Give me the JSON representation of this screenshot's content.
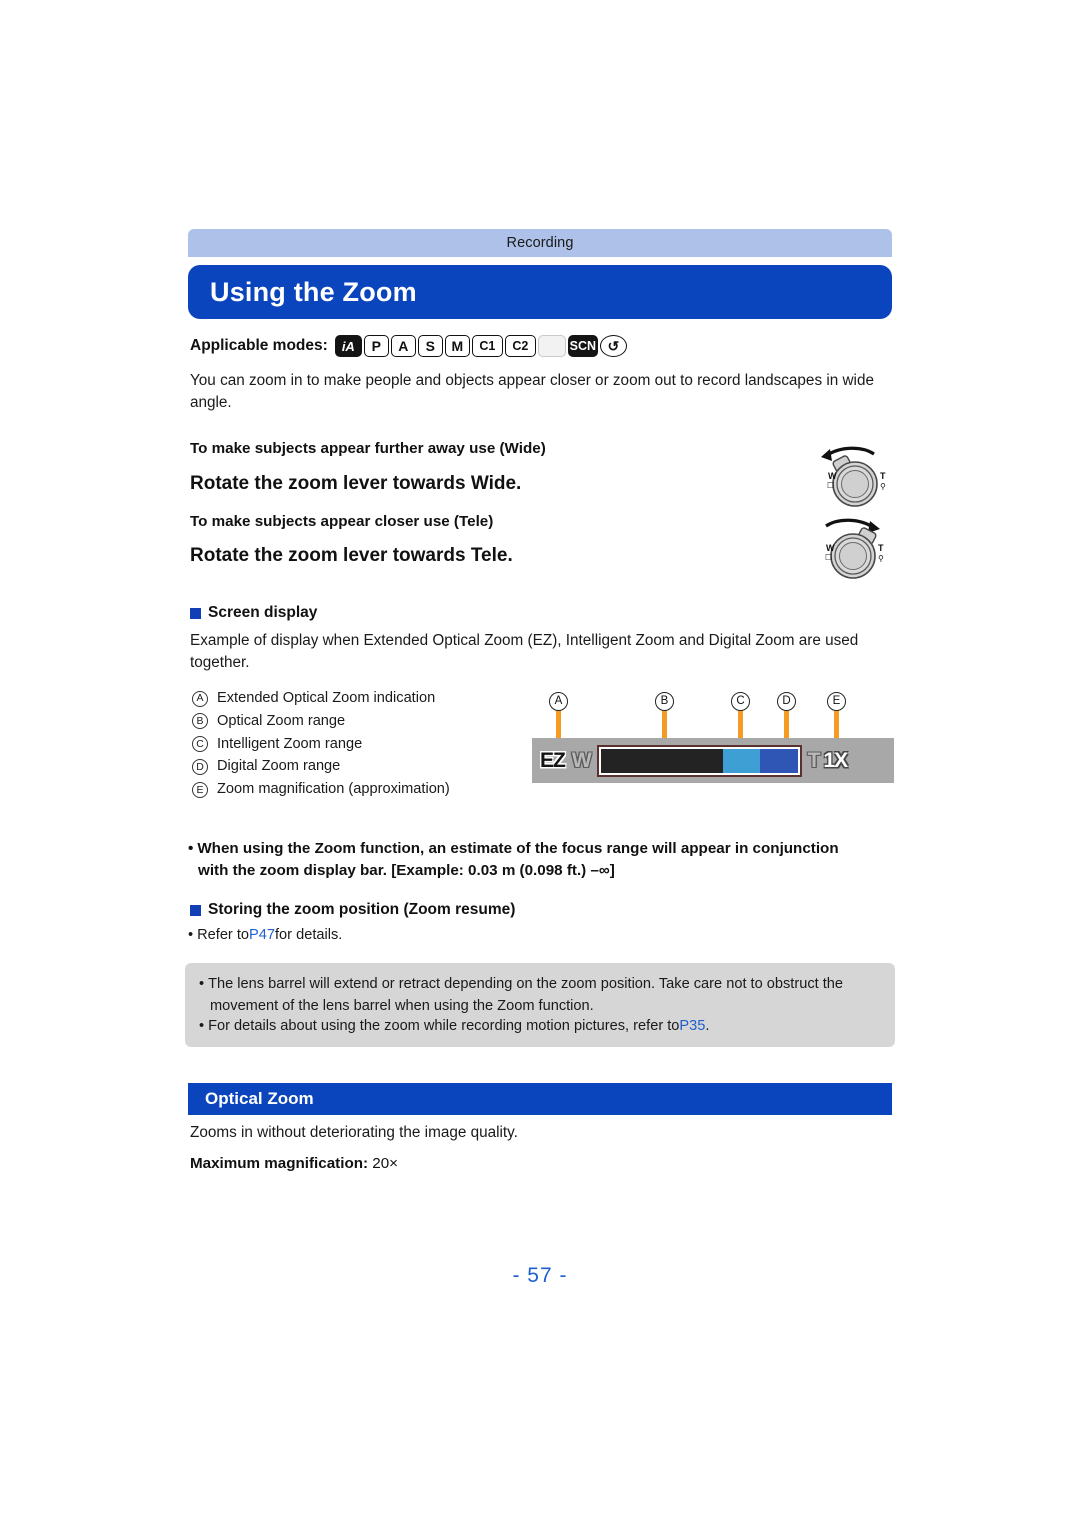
{
  "breadcrumb": {
    "label": "Recording"
  },
  "title": {
    "text": "Using the Zoom"
  },
  "applicable_modes": {
    "label": "Applicable modes:",
    "icons": [
      {
        "name": "mode-ia",
        "text": "iA",
        "style": "filled"
      },
      {
        "name": "mode-p",
        "text": "P",
        "style": "outline"
      },
      {
        "name": "mode-a",
        "text": "A",
        "style": "outline"
      },
      {
        "name": "mode-s",
        "text": "S",
        "style": "outline"
      },
      {
        "name": "mode-m",
        "text": "M",
        "style": "outline"
      },
      {
        "name": "mode-c1",
        "text": "C1",
        "style": "outline"
      },
      {
        "name": "mode-c2",
        "text": "C2",
        "style": "outline"
      },
      {
        "name": "mode-panorama",
        "text": "",
        "style": "dim"
      },
      {
        "name": "mode-scn",
        "text": "SCN",
        "style": "filled"
      },
      {
        "name": "mode-creative",
        "text": "↺",
        "style": "circle"
      }
    ]
  },
  "intro": "You can zoom in to make people and objects appear closer or zoom out to record landscapes in wide angle.",
  "wide": {
    "caption": "To make subjects appear further away use (Wide)",
    "instruction": "Rotate the zoom lever towards Wide."
  },
  "tele": {
    "caption": "To make subjects appear closer use (Tele)",
    "instruction": "Rotate the zoom lever towards Tele."
  },
  "lever_labels": {
    "wide": "W",
    "tele": "T"
  },
  "screen_display": {
    "heading": "Screen display",
    "description": "Example of display when Extended Optical Zoom (EZ), Intelligent Zoom and Digital Zoom are used together.",
    "legend": [
      {
        "key": "A",
        "text": "Extended Optical Zoom indication"
      },
      {
        "key": "B",
        "text": "Optical Zoom range"
      },
      {
        "key": "C",
        "text": "Intelligent Zoom range"
      },
      {
        "key": "D",
        "text": "Digital Zoom range"
      },
      {
        "key": "E",
        "text": "Zoom magnification (approximation)"
      }
    ]
  },
  "figure": {
    "callouts": [
      "A",
      "B",
      "C",
      "D",
      "E"
    ],
    "ez_indicator": "EZ",
    "wide_end": "W",
    "tele_end": "T",
    "magnification": "1X",
    "segments": [
      {
        "name": "optical",
        "color": "#232323",
        "width_pct": 62
      },
      {
        "name": "intelligent",
        "color": "#3d9fd4",
        "width_pct": 19
      },
      {
        "name": "digital",
        "color": "#2f56b5",
        "width_pct": 19
      }
    ],
    "leader_color": "#f59a23"
  },
  "focus_note": {
    "line1": "When using the Zoom function, an estimate of the focus range will appear in conjunction",
    "line2": "with the zoom display bar. [Example:  0.03 m (0.098 ft.) –∞]"
  },
  "zoom_resume": {
    "heading": "Storing the zoom position (Zoom resume)",
    "refer_prefix": "Refer to ",
    "link": "P47",
    "refer_suffix": " for details."
  },
  "note_box": {
    "item1_line1": "The lens barrel will extend or retract depending on the zoom position. Take care not to obstruct the",
    "item1_line2": "movement of the lens barrel when using the Zoom function.",
    "item2_prefix": "For details about using the zoom while recording motion pictures, refer to ",
    "item2_link": "P35",
    "item2_suffix": "."
  },
  "optical_zoom": {
    "heading": "Optical Zoom",
    "description": "Zooms in without deteriorating the image quality.",
    "max_label": "Maximum magnification: ",
    "max_value": "20×"
  },
  "footer": {
    "page_number": "- 57 -"
  }
}
